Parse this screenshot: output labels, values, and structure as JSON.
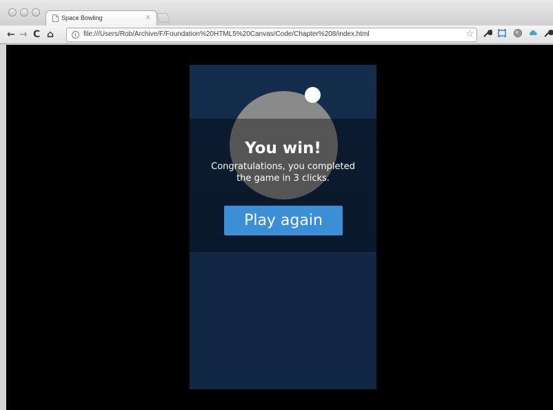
{
  "browser": {
    "tab": {
      "title": "Space Bowling",
      "close_symbol": "×"
    },
    "toolbar": {
      "back_symbol": "←",
      "forward_symbol": "→",
      "reload_symbol": "C",
      "home_symbol": "⌂",
      "url": "file:///Users/Rob/Archive/F/Foundation%20HTML5%20Canvas/Code/Chapter%208/index.html",
      "bookmark_symbol": "☆",
      "icons": [
        "wrench-icon",
        "screen-capture-icon",
        "globe-icon",
        "cloud-icon",
        "wrench-menu-icon"
      ]
    }
  },
  "game": {
    "title": "You win!",
    "message": "Congratulations, you completed the game in 3 clicks.",
    "clicks": 3,
    "button_label": "Play again"
  },
  "colors": {
    "canvas_background": "#102846",
    "platform": "#8a8a8a",
    "button": "#3b8fd6",
    "viewport": "#000000"
  }
}
